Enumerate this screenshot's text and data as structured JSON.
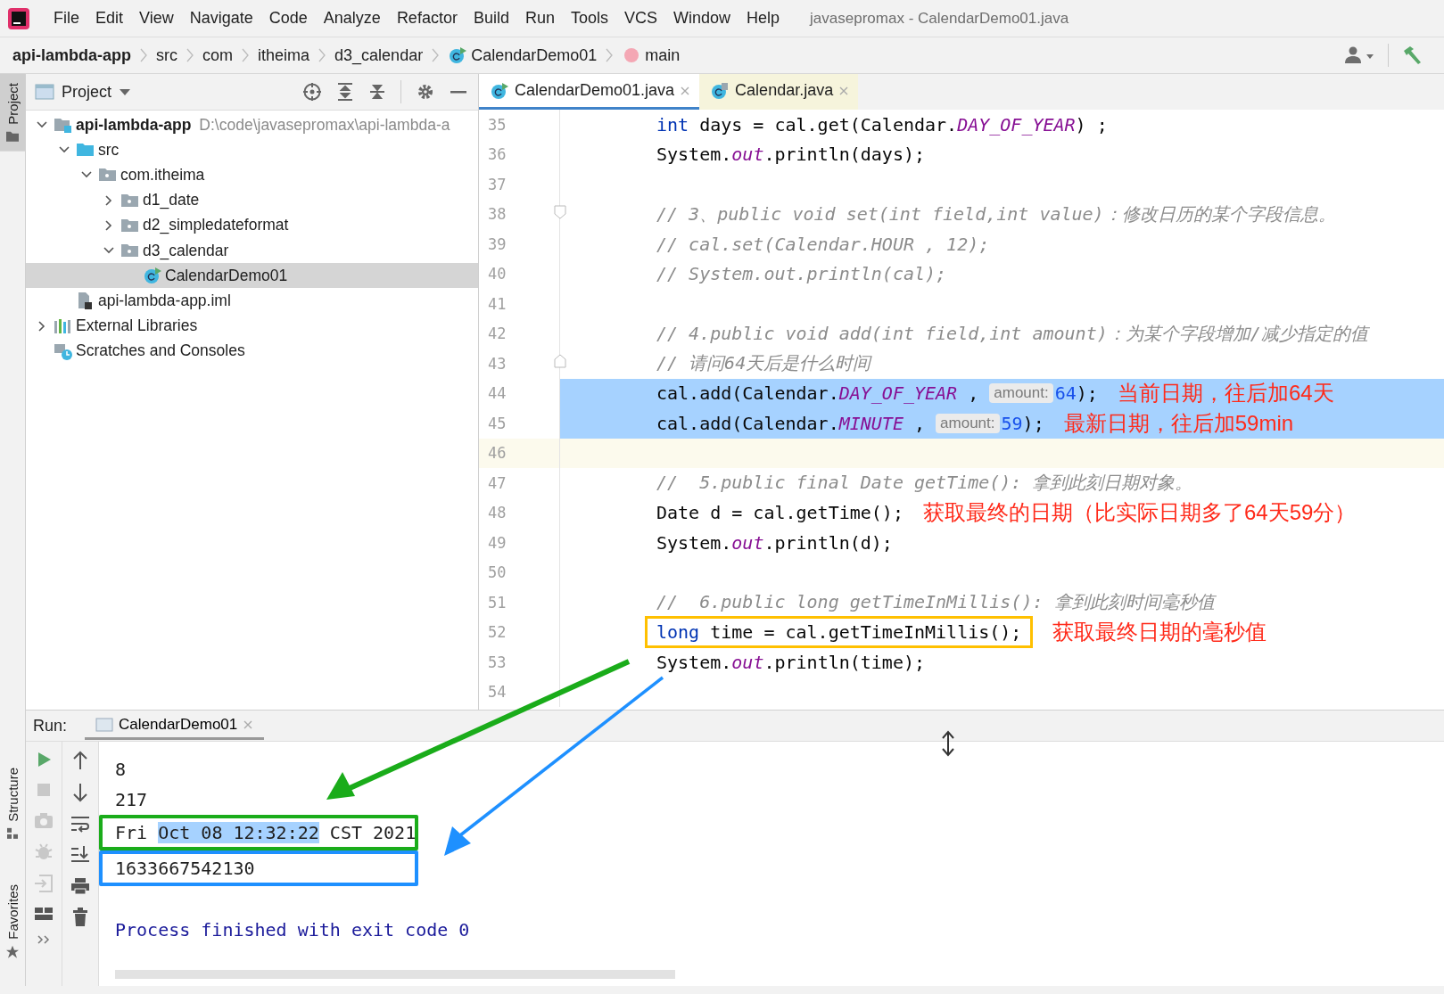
{
  "window": {
    "title": "javasepromax - CalendarDemo01.java"
  },
  "menu": [
    {
      "label": "File"
    },
    {
      "label": "Edit"
    },
    {
      "label": "View"
    },
    {
      "label": "Navigate"
    },
    {
      "label": "Code"
    },
    {
      "label": "Analyze"
    },
    {
      "label": "Refactor"
    },
    {
      "label": "Build"
    },
    {
      "label": "Run"
    },
    {
      "label": "Tools"
    },
    {
      "label": "VCS"
    },
    {
      "label": "Window"
    },
    {
      "label": "Help"
    }
  ],
  "breadcrumbs": [
    {
      "label": "api-lambda-app",
      "kind": "module"
    },
    {
      "label": "src",
      "kind": "folder"
    },
    {
      "label": "com",
      "kind": "folder"
    },
    {
      "label": "itheima",
      "kind": "folder"
    },
    {
      "label": "d3_calendar",
      "kind": "folder"
    },
    {
      "label": "CalendarDemo01",
      "kind": "class"
    },
    {
      "label": "main",
      "kind": "method"
    }
  ],
  "side_tabs": [
    {
      "label": "Project",
      "selected": true
    },
    {
      "label": "Structure",
      "selected": false
    },
    {
      "label": "Favorites",
      "selected": false
    }
  ],
  "project": {
    "title": "Project",
    "tree": [
      {
        "name": "api-lambda-app",
        "kind": "module",
        "path": "D:\\code\\javasepromax\\api-lambda-a",
        "expanded": true,
        "selected": false,
        "children": [
          {
            "name": "src",
            "kind": "source-folder",
            "expanded": true,
            "selected": false,
            "children": [
              {
                "name": "com.itheima",
                "kind": "package",
                "expanded": true,
                "selected": false,
                "children": [
                  {
                    "name": "d1_date",
                    "kind": "package",
                    "expanded": false,
                    "selected": false
                  },
                  {
                    "name": "d2_simpledateformat",
                    "kind": "package",
                    "expanded": false,
                    "selected": false
                  },
                  {
                    "name": "d3_calendar",
                    "kind": "package",
                    "expanded": true,
                    "selected": false,
                    "children": [
                      {
                        "name": "CalendarDemo01",
                        "kind": "class",
                        "selected": true
                      }
                    ]
                  }
                ]
              }
            ]
          },
          {
            "name": "api-lambda-app.iml",
            "kind": "file",
            "selected": false
          }
        ]
      },
      {
        "name": "External Libraries",
        "kind": "libraries",
        "expanded": false,
        "selected": false
      },
      {
        "name": "Scratches and Consoles",
        "kind": "scratches",
        "selected": false
      }
    ]
  },
  "editor_tabs": [
    {
      "label": "CalendarDemo01.java",
      "kind": "class",
      "selected": true
    },
    {
      "label": "Calendar.java",
      "kind": "library",
      "selected": false
    }
  ],
  "code_lines": [
    {
      "number": "35",
      "selected": false,
      "current": false,
      "fold_start": false,
      "fold_end": false,
      "segments": [
        {
          "kind": "keyword",
          "text": "int"
        },
        {
          "kind": "plain",
          "text": " days = cal.get(Calendar."
        },
        {
          "kind": "field",
          "text": "DAY_OF_YEAR"
        },
        {
          "kind": "plain",
          "text": ") ;"
        }
      ]
    },
    {
      "number": "36",
      "selected": false,
      "current": false,
      "fold_start": false,
      "fold_end": false,
      "segments": [
        {
          "kind": "plain",
          "text": "System."
        },
        {
          "kind": "field",
          "text": "out"
        },
        {
          "kind": "plain",
          "text": ".println(days);"
        }
      ]
    },
    {
      "number": "37",
      "selected": false,
      "current": false,
      "fold_start": false,
      "fold_end": false
    },
    {
      "number": "38",
      "selected": false,
      "current": false,
      "fold_start": true,
      "fold_end": false,
      "segments": [
        {
          "kind": "comment",
          "text": "// 3、public void set(int field,int value)：修改日历的某个字段信息。"
        }
      ]
    },
    {
      "number": "39",
      "selected": false,
      "current": false,
      "fold_start": false,
      "fold_end": false,
      "segments": [
        {
          "kind": "comment",
          "text": "// cal.set(Calendar.HOUR , 12);"
        }
      ]
    },
    {
      "number": "40",
      "selected": false,
      "current": false,
      "fold_start": false,
      "fold_end": false,
      "segments": [
        {
          "kind": "comment",
          "text": "// System.out.println(cal);"
        }
      ]
    },
    {
      "number": "41",
      "selected": false,
      "current": false,
      "fold_start": false,
      "fold_end": false
    },
    {
      "number": "42",
      "selected": false,
      "current": false,
      "fold_start": false,
      "fold_end": false,
      "segments": [
        {
          "kind": "comment",
          "text": "// 4.public void add(int field,int amount)：为某个字段增加/减少指定的值"
        }
      ]
    },
    {
      "number": "43",
      "selected": false,
      "current": false,
      "fold_start": false,
      "fold_end": true,
      "segments": [
        {
          "kind": "comment",
          "text": "// 请问64天后是什么时间"
        }
      ]
    },
    {
      "number": "44",
      "selected": true,
      "current": false,
      "fold_start": false,
      "fold_end": false,
      "note": "当前日期，往后加64天",
      "segments": [
        {
          "kind": "plain",
          "text": "cal.add(Calendar."
        },
        {
          "kind": "field",
          "text": "DAY_OF_YEAR"
        },
        {
          "kind": "plain",
          "text": " , "
        },
        {
          "kind": "hint",
          "text": "amount:"
        },
        {
          "kind": "number",
          "text": "64"
        },
        {
          "kind": "plain",
          "text": ");"
        }
      ]
    },
    {
      "number": "45",
      "selected": true,
      "current": false,
      "fold_start": false,
      "fold_end": false,
      "note": "最新日期，往后加59min",
      "segments": [
        {
          "kind": "plain",
          "text": "cal.add(Calendar."
        },
        {
          "kind": "field",
          "text": "MINUTE"
        },
        {
          "kind": "plain",
          "text": " , "
        },
        {
          "kind": "hint",
          "text": "amount:"
        },
        {
          "kind": "number",
          "text": "59"
        },
        {
          "kind": "plain",
          "text": ");"
        }
      ]
    },
    {
      "number": "46",
      "selected": false,
      "current": true,
      "fold_start": false,
      "fold_end": false
    },
    {
      "number": "47",
      "selected": false,
      "current": false,
      "fold_start": false,
      "fold_end": false,
      "segments": [
        {
          "kind": "comment",
          "text": "//  5.public final Date getTime(): 拿到此刻日期对象。"
        }
      ]
    },
    {
      "number": "48",
      "selected": false,
      "current": false,
      "fold_start": false,
      "fold_end": false,
      "note": "获取最终的日期（比实际日期多了64天59分）",
      "segments": [
        {
          "kind": "plain",
          "text": "Date d = cal.getTime();"
        }
      ]
    },
    {
      "number": "49",
      "selected": false,
      "current": false,
      "fold_start": false,
      "fold_end": false,
      "segments": [
        {
          "kind": "plain",
          "text": "System."
        },
        {
          "kind": "field",
          "text": "out"
        },
        {
          "kind": "plain",
          "text": ".println(d);"
        }
      ]
    },
    {
      "number": "50",
      "selected": false,
      "current": false,
      "fold_start": false,
      "fold_end": false
    },
    {
      "number": "51",
      "selected": false,
      "current": false,
      "fold_start": false,
      "fold_end": false,
      "segments": [
        {
          "kind": "comment",
          "text": "//  6.public long getTimeInMillis(): 拿到此刻时间毫秒值"
        }
      ]
    },
    {
      "number": "52",
      "selected": false,
      "current": false,
      "fold_start": false,
      "fold_end": false,
      "color": "#ffc000",
      "note": "获取最终日期的毫秒值",
      "segments": [
        {
          "kind": "keyword",
          "text": "long"
        },
        {
          "kind": "plain",
          "text": " time = cal.getTimeInMillis();"
        }
      ]
    },
    {
      "number": "53",
      "selected": false,
      "current": false,
      "fold_start": false,
      "fold_end": false,
      "segments": [
        {
          "kind": "plain",
          "text": "System."
        },
        {
          "kind": "field",
          "text": "out"
        },
        {
          "kind": "plain",
          "text": ".println(time);"
        }
      ]
    },
    {
      "number": "54",
      "selected": false,
      "current": false,
      "fold_start": false,
      "fold_end": false
    }
  ],
  "run": {
    "label": "Run:",
    "tabs": [
      {
        "label": "CalendarDemo01",
        "selected": true
      }
    ],
    "output": [
      {
        "kind": "stdout",
        "segments": [
          {
            "text": "8",
            "selected": false
          }
        ]
      },
      {
        "kind": "stdout",
        "segments": [
          {
            "text": "217",
            "selected": false
          }
        ]
      },
      {
        "kind": "stdout",
        "color": "#1aac1a",
        "segments": [
          {
            "text": "Fri ",
            "selected": false
          },
          {
            "text": "Oct 08 12:32:22",
            "selected": true
          },
          {
            "text": " CST 2021",
            "selected": false
          }
        ]
      },
      {
        "kind": "stdout",
        "color": "#1e90ff",
        "segments": [
          {
            "text": "1633667542130",
            "selected": false
          }
        ]
      },
      {
        "kind": "system",
        "segments": [
          {
            "text": "Process finished with exit code 0",
            "selected": false
          }
        ]
      }
    ]
  }
}
